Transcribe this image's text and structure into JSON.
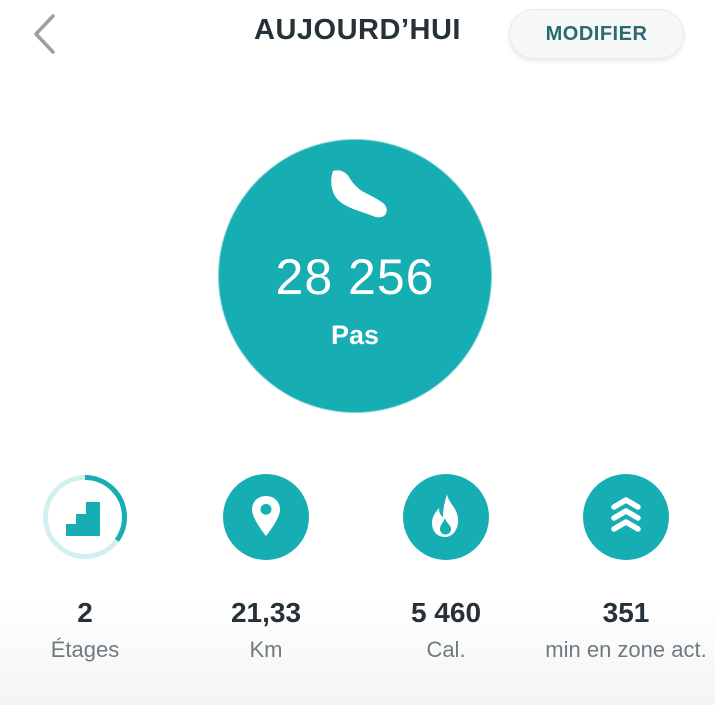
{
  "header": {
    "title": "AUJOURD’HUI",
    "edit_label": "MODIFIER"
  },
  "steps": {
    "value": "28 256",
    "label": "Pas",
    "icon": "shoe-icon"
  },
  "stats": [
    {
      "value": "2",
      "label": "Étages",
      "icon": "stairs-icon",
      "progress": 0.35
    },
    {
      "value": "21,33",
      "label": "Km",
      "icon": "location-pin-icon"
    },
    {
      "value": "5 460",
      "label": "Cal.",
      "icon": "flame-icon"
    },
    {
      "value": "351",
      "label": "min en zone act.",
      "icon": "active-zone-chevrons-icon"
    }
  ],
  "colors": {
    "accent": "#16adb3",
    "progress_track": "#d3eff0",
    "text_primary": "#263238",
    "text_secondary": "#6f7b80"
  }
}
